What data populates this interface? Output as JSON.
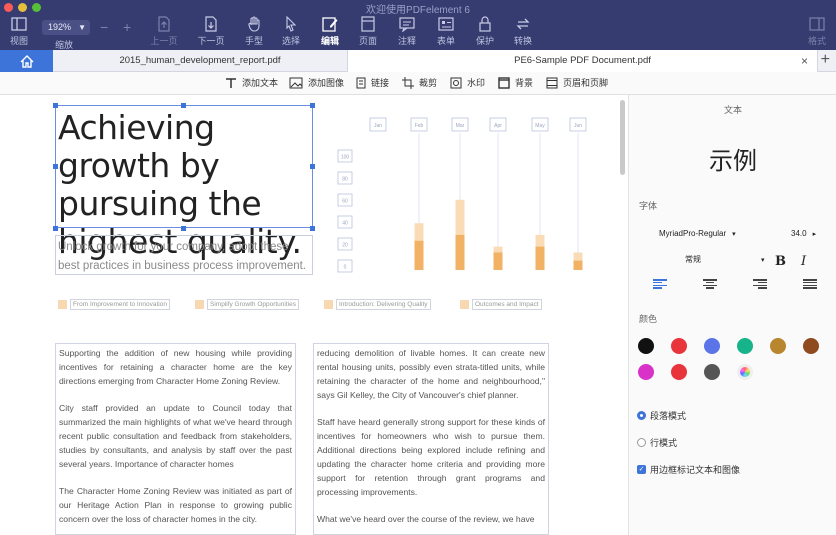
{
  "window": {
    "title": "欢迎使用PDFelement 6"
  },
  "toolbar": {
    "view_label": "视图",
    "zoom_value": "192%",
    "zoom_label": "缩放",
    "prev_label": "上一页",
    "next_label": "下一页",
    "hand_label": "手型",
    "select_label": "选择",
    "edit_label": "编辑",
    "page_label": "页面",
    "comment_label": "注释",
    "form_label": "表单",
    "protect_label": "保护",
    "convert_label": "转换",
    "format_label": "格式"
  },
  "tabs": [
    {
      "label": "2015_human_development_report.pdf"
    },
    {
      "label": "PE6-Sample PDF Document.pdf"
    }
  ],
  "edit_toolbar": {
    "add_text": "添加文本",
    "add_image": "添加图像",
    "link": "链接",
    "crop": "裁剪",
    "watermark": "水印",
    "background": "背景",
    "header_footer": "页眉和页脚"
  },
  "document": {
    "headline": "Achieving growth by pursuing the highest quality.",
    "subhead": "Unlock growth for your company, adopt these best practices in business process improvement.",
    "categories": [
      "From Improvement to Innovation",
      "Simplify Growth Opportunities",
      "Introduction: Delivering Quality",
      "Outcomes and Impact"
    ],
    "col1": [
      "Supporting the addition of new housing while providing incentives for retaining a character home are the key directions emerging from Character Home Zoning Review.",
      "City staff provided an update to Council today that summarized the main highlights of what we've heard through recent public consultation and feedback from stakeholders, studies by consultants, and analysis by staff over the past several years. Importance of character homes",
      "The Character Home Zoning Review was initiated as part of our Heritage Action Plan in response to growing public concern over the loss of character homes in the city."
    ],
    "col2": [
      "reducing demolition of livable homes. It can create new rental housing units, possibly even strata-titled units, while retaining the character of the home and neighbourhood,\" says Gil Kelley, the City of Vancouver's chief planner.",
      "Staff have heard generally strong support for these kinds of incentives for homeowners who wish to pursue them. Additional directions being explored include refining and updating the character home criteria and providing more support for retention through grant programs and processing improvements.",
      "What we've heard over the course of the review, we have"
    ]
  },
  "chart_data": {
    "type": "bar",
    "categories": [
      "Jan",
      "Feb",
      "Mar",
      "Apr",
      "May",
      "Jun"
    ],
    "series": [
      {
        "values": [
          null,
          40,
          60,
          20,
          30,
          15
        ]
      },
      {
        "values": [
          null,
          25,
          30,
          15,
          20,
          8
        ]
      }
    ],
    "y_tick_labels": [
      "100",
      "80",
      "60",
      "40",
      "20",
      "0"
    ]
  },
  "panel": {
    "title": "文本",
    "sample": "示例",
    "font_label": "字体",
    "font_family": "MyriadPro-Regular",
    "font_size": "34.0",
    "font_style": "常规",
    "bold": "B",
    "italic": "I",
    "color_label": "颜色",
    "colors": [
      "#111111",
      "#e8353b",
      "#5b74e8",
      "#17b38a",
      "#b8862f",
      "#8f4a1f",
      "#d932c8",
      "#e8353b",
      "#555555",
      "rainbow"
    ],
    "paragraph_mode": "段落模式",
    "line_mode": "行模式",
    "box_option": "用边框标记文本和图像"
  }
}
